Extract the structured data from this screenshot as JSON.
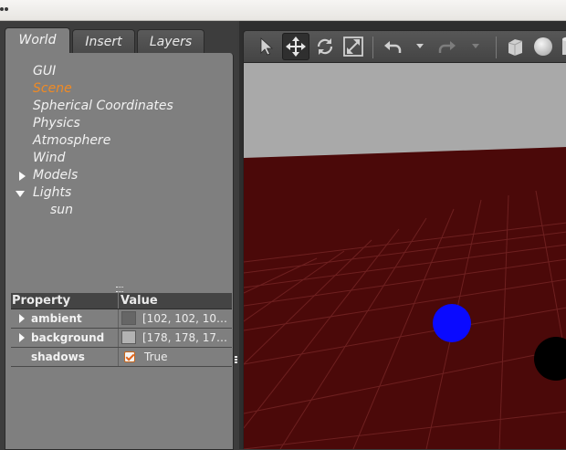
{
  "tabs": [
    {
      "label": "World",
      "active": true
    },
    {
      "label": "Insert",
      "active": false
    },
    {
      "label": "Layers",
      "active": false
    }
  ],
  "tree": {
    "items": [
      {
        "label": "GUI",
        "selected": false,
        "expander": "none"
      },
      {
        "label": "Scene",
        "selected": true,
        "expander": "none"
      },
      {
        "label": "Spherical Coordinates",
        "selected": false,
        "expander": "none"
      },
      {
        "label": "Physics",
        "selected": false,
        "expander": "none"
      },
      {
        "label": "Atmosphere",
        "selected": false,
        "expander": "none"
      },
      {
        "label": "Wind",
        "selected": false,
        "expander": "none"
      },
      {
        "label": "Models",
        "selected": false,
        "expander": "collapsed"
      },
      {
        "label": "Lights",
        "selected": false,
        "expander": "expanded"
      },
      {
        "label": "sun",
        "selected": false,
        "expander": "none",
        "child_of": "Lights"
      }
    ],
    "selected_color": "#f08a24"
  },
  "properties": {
    "header": {
      "property": "Property",
      "value": "Value"
    },
    "rows": [
      {
        "name": "ambient",
        "value": "[102, 102, 10…",
        "swatch": "#666666",
        "expandable": true
      },
      {
        "name": "background",
        "value": "[178, 178, 17…",
        "swatch": "#b2b2b2",
        "expandable": true
      },
      {
        "name": "shadows",
        "value": "True",
        "checked": true,
        "expandable": false
      }
    ]
  },
  "toolbar": {
    "tools": [
      {
        "name": "select-tool",
        "icon": "arrow-cursor-icon",
        "active": false
      },
      {
        "name": "translate-tool",
        "icon": "move-arrows-icon",
        "active": true
      },
      {
        "name": "rotate-tool",
        "icon": "rotate-icon",
        "active": false
      },
      {
        "name": "scale-tool",
        "icon": "scale-icon",
        "active": false
      },
      {
        "name": "undo",
        "icon": "undo-icon",
        "active": false
      },
      {
        "name": "redo",
        "icon": "redo-icon",
        "active": false,
        "disabled": true
      },
      {
        "name": "box-shape",
        "icon": "box-icon",
        "active": false
      },
      {
        "name": "sphere-shape",
        "icon": "sphere-icon",
        "active": false
      },
      {
        "name": "cylinder-shape",
        "icon": "cylinder-icon",
        "active": false
      }
    ]
  },
  "scene": {
    "sky_color": "#a9a9a9",
    "ground_color": "#4b0909",
    "grid_color": "#6e2020",
    "objects": [
      {
        "name": "blue-sphere",
        "color": "#0a0aff"
      },
      {
        "name": "black-sphere",
        "color": "#000000"
      }
    ]
  }
}
